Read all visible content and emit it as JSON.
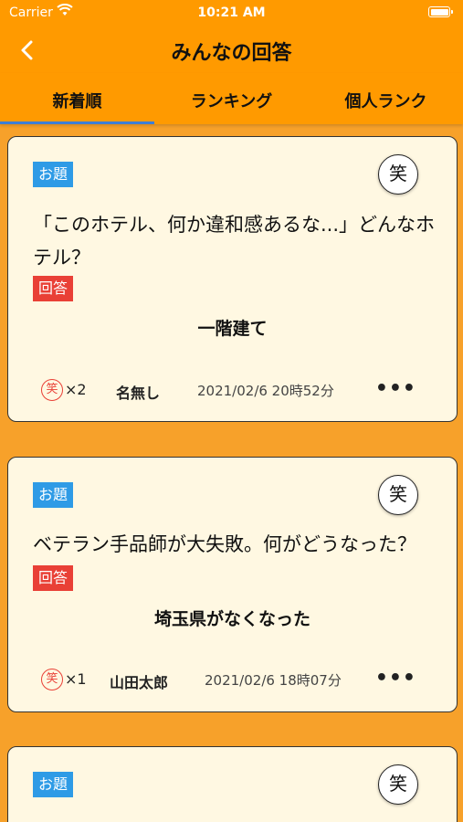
{
  "status": {
    "carrier": "Carrier",
    "time": "10:21 AM"
  },
  "nav": {
    "title": "みんなの回答"
  },
  "tabs": [
    "新着順",
    "ランキング",
    "個人ランク"
  ],
  "labels": {
    "topic": "お題",
    "answer": "回答",
    "laugh": "笑",
    "stamp": "笑"
  },
  "posts": [
    {
      "topic": "「このホテル、何か違和感あるな...」どんなホテル？",
      "answer": "一階建て",
      "count": "×2",
      "user": "名無し",
      "date": "2021/02/6 20時52分"
    },
    {
      "topic": "ベテラン手品師が大失敗。何がどうなった？",
      "answer": "埼玉県がなくなった",
      "count": "×1",
      "user": "山田太郎",
      "date": "2021/02/6 18時07分"
    }
  ],
  "colors": {
    "background": "#F7A12A",
    "header": "#FF9A00",
    "card": "#FFF8E2",
    "topic_badge": "#2E9BE6",
    "answer_badge": "#E94036",
    "tab_indicator": "#3D7FD6"
  }
}
